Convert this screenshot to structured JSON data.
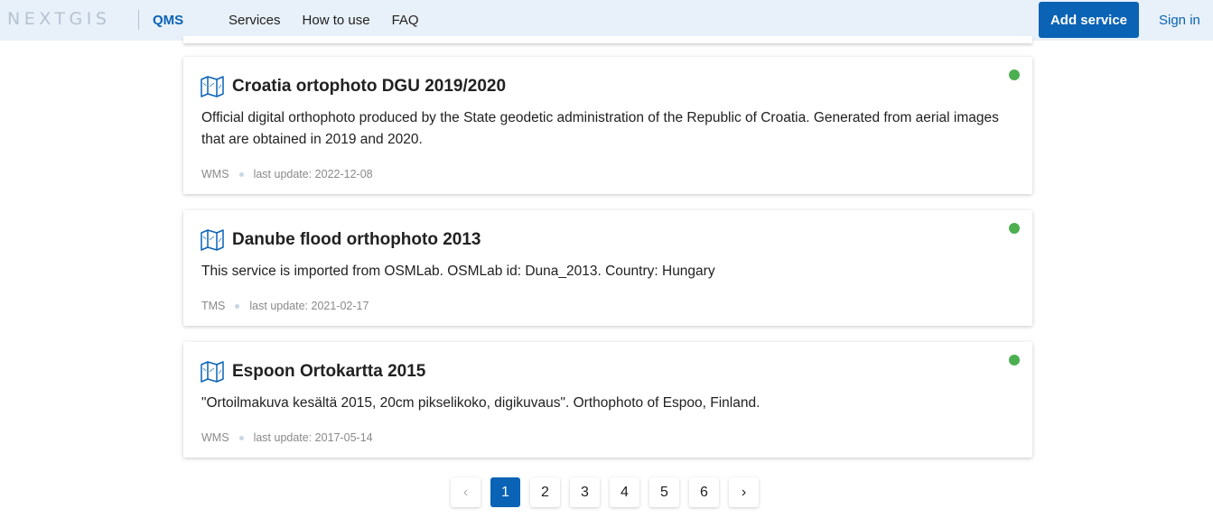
{
  "header": {
    "logo": "NEXTGIS",
    "app_name": "QMS",
    "nav": [
      "Services",
      "How to use",
      "FAQ"
    ],
    "add_service": "Add service",
    "sign_in": "Sign in"
  },
  "services": [
    {
      "title": "Croatia ortophoto DGU 2019/2020",
      "description": "Official digital orthophoto produced by the State geodetic administration of the Republic of Croatia. Generated from aerial images that are obtained in 2019 and 2020.",
      "type": "WMS",
      "last_update": "last update: 2022-12-08",
      "status_color": "#4caf50"
    },
    {
      "title": "Danube flood orthophoto 2013",
      "description": "This service is imported from OSMLab. OSMLab id: Duna_2013. Country: Hungary",
      "type": "TMS",
      "last_update": "last update: 2021-02-17",
      "status_color": "#4caf50"
    },
    {
      "title": "Espoon Ortokartta 2015",
      "description": "\"Ortoilmakuva kesältä 2015, 20cm pikselikoko, digikuvaus\". Orthophoto of Espoo, Finland.",
      "type": "WMS",
      "last_update": "last update: 2017-05-14",
      "status_color": "#4caf50"
    }
  ],
  "pagination": {
    "prev": "‹",
    "pages": [
      "1",
      "2",
      "3",
      "4",
      "5",
      "6"
    ],
    "current": "1",
    "next": "›"
  },
  "colors": {
    "accent": "#0a63b5",
    "header_bg": "#e8f0f9",
    "status_ok": "#4caf50"
  }
}
